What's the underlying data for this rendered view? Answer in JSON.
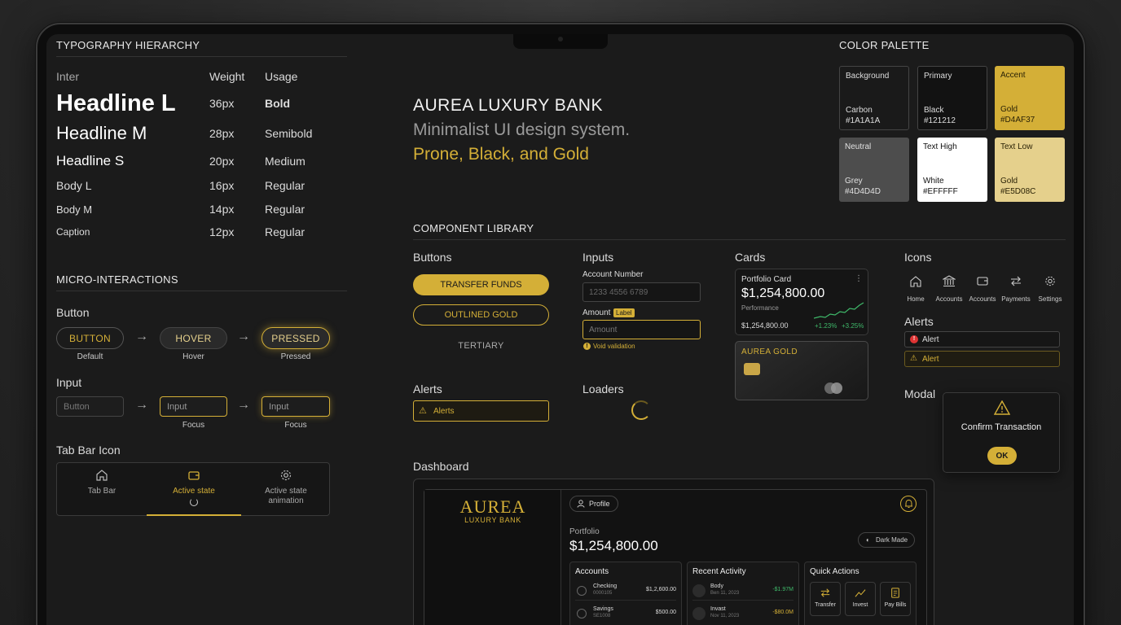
{
  "typography": {
    "title": "TYPOGRAPHY HIERARCHY",
    "headers": {
      "font": "Inter",
      "weight": "Weight",
      "usage": "Usage"
    },
    "rows": [
      {
        "name": "Headline L",
        "size": "36px",
        "usage": "Bold"
      },
      {
        "name": "Headline M",
        "size": "28px",
        "usage": "Semibold"
      },
      {
        "name": "Headline S",
        "size": "20px",
        "usage": "Medium"
      },
      {
        "name": "Body L",
        "size": "16px",
        "usage": "Regular"
      },
      {
        "name": "Body M",
        "size": "14px",
        "usage": "Regular"
      },
      {
        "name": "Caption",
        "size": "12px",
        "usage": "Regular"
      }
    ]
  },
  "micro": {
    "title": "MICRO-INTERACTIONS",
    "button_label": "Button",
    "buttons": [
      {
        "text": "BUTTON",
        "caption": "Default"
      },
      {
        "text": "HOVER",
        "caption": "Hover"
      },
      {
        "text": "PRESSED",
        "caption": "Pressed"
      }
    ],
    "input_label": "Input",
    "inputs": [
      {
        "placeholder": "Button",
        "caption": ""
      },
      {
        "placeholder": "Input",
        "caption": "Focus"
      },
      {
        "placeholder": "Input",
        "caption": "Focus"
      }
    ],
    "tabbar_label": "Tab Bar Icon",
    "tabs": [
      {
        "label": "Tab Bar",
        "icon": "home-icon"
      },
      {
        "label": "Active state",
        "icon": "wallet-icon"
      },
      {
        "label": "Active state animation",
        "icon": "gear-icon"
      }
    ]
  },
  "hero": {
    "title": "AUREA LUXURY BANK",
    "line1": "Minimalist UI design system.",
    "line2": "Prone, Black, and Gold"
  },
  "palette": {
    "title": "COLOR PALETTE",
    "swatches": [
      {
        "role": "Background",
        "name": "Carbon",
        "hex": "#1A1A1A",
        "color": "#1A1A1A"
      },
      {
        "role": "Primary",
        "name": "Black",
        "hex": "#121212",
        "color": "#121212"
      },
      {
        "role": "Accent",
        "name": "Gold",
        "hex": "#D4AF37",
        "color": "#D4AF37"
      },
      {
        "role": "Neutral",
        "name": "Grey",
        "hex": "#4D4D4D",
        "color": "#4D4D4D"
      },
      {
        "role": "Text High",
        "name": "White",
        "hex": "#EFFFFF",
        "color": "#FFFFFF"
      },
      {
        "role": "Text Low",
        "name": "Gold",
        "hex": "#E5D08C",
        "color": "#E5D08C"
      }
    ]
  },
  "library": {
    "title": "COMPONENT LIBRARY",
    "buttons_title": "Buttons",
    "btn_primary": "TRANSFER FUNDS",
    "btn_outline": "OUTLINED GOLD",
    "btn_tertiary": "TERTIARY",
    "inputs_title": "Inputs",
    "account_label": "Account Number",
    "account_value": "1233 4556 6789",
    "amount_label": "Amount",
    "amount_badge": "Label",
    "amount_placeholder": "Amount",
    "void_text": "Void validation",
    "cards_title": "Cards",
    "card_title": "Portfolio Card",
    "card_amount": "$1,254,800.00",
    "card_perf": "Performance",
    "card_value": "$1,254,800.00",
    "card_change1": "+1.23%",
    "card_change2": "+3.25%",
    "gold_card": "AUREA GOLD",
    "icons_title": "Icons",
    "icons": [
      {
        "label": "Home",
        "icon": "home-icon"
      },
      {
        "label": "Accounts",
        "icon": "bank-icon"
      },
      {
        "label": "Accounts",
        "icon": "wallet-icon"
      },
      {
        "label": "Payments",
        "icon": "transfer-icon"
      },
      {
        "label": "Settings",
        "icon": "gear-icon"
      }
    ],
    "alerts_title_right": "Alerts",
    "alert1": "Alert",
    "alert2": "Alert",
    "alerts_title": "Alerts",
    "alerts_box": "Alerts",
    "loaders_title": "Loaders",
    "modal_title": "Modal",
    "modal_text": "Confirm Transaction",
    "modal_ok": "OK"
  },
  "dashboard": {
    "title": "Dashboard",
    "logo": "AUREA",
    "logo_sub": "LUXURY BANK",
    "profile": "Profile",
    "portfolio_label": "Portfolio",
    "portfolio_value": "$1,254,800.00",
    "dark_mode": "Dark Made",
    "accounts_title": "Accounts",
    "accounts": [
      {
        "name": "Checking",
        "num": "0000105",
        "amount": "$1,2,600.00"
      },
      {
        "name": "Savings",
        "num": "SE1008",
        "amount": "$500.00"
      }
    ],
    "activity_title": "Recent Activity",
    "activity": [
      {
        "name": "Body",
        "date": "Ben 11, 2023",
        "amount": "-$1.97M"
      },
      {
        "name": "Invast",
        "date": "Nov 11, 2023",
        "amount": "-$80.0M"
      }
    ],
    "quick_title": "Quick Actions",
    "quick": [
      {
        "label": "Transfer",
        "icon": "transfer-icon"
      },
      {
        "label": "Invest",
        "icon": "chart-icon"
      },
      {
        "label": "Pay Bills",
        "icon": "bill-icon"
      }
    ]
  }
}
